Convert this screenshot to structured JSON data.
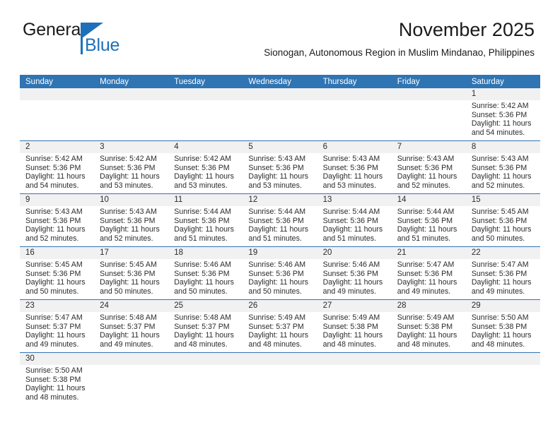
{
  "logo": {
    "text_primary": "General",
    "text_secondary": "Blue",
    "color_primary": "#1a1a1a",
    "color_secondary": "#1d70b7"
  },
  "header": {
    "title": "November 2025",
    "subtitle": "Sionogan, Autonomous Region in Muslim Mindanao, Philippines"
  },
  "theme": {
    "header_blue": "#2f74b3",
    "daynum_band": "#f1f1f1",
    "text": "#2b2b2b"
  },
  "calendar": {
    "weekdays": [
      "Sunday",
      "Monday",
      "Tuesday",
      "Wednesday",
      "Thursday",
      "Friday",
      "Saturday"
    ],
    "weeks": [
      [
        {
          "day": "",
          "lines": []
        },
        {
          "day": "",
          "lines": []
        },
        {
          "day": "",
          "lines": []
        },
        {
          "day": "",
          "lines": []
        },
        {
          "day": "",
          "lines": []
        },
        {
          "day": "",
          "lines": []
        },
        {
          "day": "1",
          "lines": [
            "Sunrise: 5:42 AM",
            "Sunset: 5:36 PM",
            "Daylight: 11 hours",
            "and 54 minutes."
          ]
        }
      ],
      [
        {
          "day": "2",
          "lines": [
            "Sunrise: 5:42 AM",
            "Sunset: 5:36 PM",
            "Daylight: 11 hours",
            "and 54 minutes."
          ]
        },
        {
          "day": "3",
          "lines": [
            "Sunrise: 5:42 AM",
            "Sunset: 5:36 PM",
            "Daylight: 11 hours",
            "and 53 minutes."
          ]
        },
        {
          "day": "4",
          "lines": [
            "Sunrise: 5:42 AM",
            "Sunset: 5:36 PM",
            "Daylight: 11 hours",
            "and 53 minutes."
          ]
        },
        {
          "day": "5",
          "lines": [
            "Sunrise: 5:43 AM",
            "Sunset: 5:36 PM",
            "Daylight: 11 hours",
            "and 53 minutes."
          ]
        },
        {
          "day": "6",
          "lines": [
            "Sunrise: 5:43 AM",
            "Sunset: 5:36 PM",
            "Daylight: 11 hours",
            "and 53 minutes."
          ]
        },
        {
          "day": "7",
          "lines": [
            "Sunrise: 5:43 AM",
            "Sunset: 5:36 PM",
            "Daylight: 11 hours",
            "and 52 minutes."
          ]
        },
        {
          "day": "8",
          "lines": [
            "Sunrise: 5:43 AM",
            "Sunset: 5:36 PM",
            "Daylight: 11 hours",
            "and 52 minutes."
          ]
        }
      ],
      [
        {
          "day": "9",
          "lines": [
            "Sunrise: 5:43 AM",
            "Sunset: 5:36 PM",
            "Daylight: 11 hours",
            "and 52 minutes."
          ]
        },
        {
          "day": "10",
          "lines": [
            "Sunrise: 5:43 AM",
            "Sunset: 5:36 PM",
            "Daylight: 11 hours",
            "and 52 minutes."
          ]
        },
        {
          "day": "11",
          "lines": [
            "Sunrise: 5:44 AM",
            "Sunset: 5:36 PM",
            "Daylight: 11 hours",
            "and 51 minutes."
          ]
        },
        {
          "day": "12",
          "lines": [
            "Sunrise: 5:44 AM",
            "Sunset: 5:36 PM",
            "Daylight: 11 hours",
            "and 51 minutes."
          ]
        },
        {
          "day": "13",
          "lines": [
            "Sunrise: 5:44 AM",
            "Sunset: 5:36 PM",
            "Daylight: 11 hours",
            "and 51 minutes."
          ]
        },
        {
          "day": "14",
          "lines": [
            "Sunrise: 5:44 AM",
            "Sunset: 5:36 PM",
            "Daylight: 11 hours",
            "and 51 minutes."
          ]
        },
        {
          "day": "15",
          "lines": [
            "Sunrise: 5:45 AM",
            "Sunset: 5:36 PM",
            "Daylight: 11 hours",
            "and 50 minutes."
          ]
        }
      ],
      [
        {
          "day": "16",
          "lines": [
            "Sunrise: 5:45 AM",
            "Sunset: 5:36 PM",
            "Daylight: 11 hours",
            "and 50 minutes."
          ]
        },
        {
          "day": "17",
          "lines": [
            "Sunrise: 5:45 AM",
            "Sunset: 5:36 PM",
            "Daylight: 11 hours",
            "and 50 minutes."
          ]
        },
        {
          "day": "18",
          "lines": [
            "Sunrise: 5:46 AM",
            "Sunset: 5:36 PM",
            "Daylight: 11 hours",
            "and 50 minutes."
          ]
        },
        {
          "day": "19",
          "lines": [
            "Sunrise: 5:46 AM",
            "Sunset: 5:36 PM",
            "Daylight: 11 hours",
            "and 50 minutes."
          ]
        },
        {
          "day": "20",
          "lines": [
            "Sunrise: 5:46 AM",
            "Sunset: 5:36 PM",
            "Daylight: 11 hours",
            "and 49 minutes."
          ]
        },
        {
          "day": "21",
          "lines": [
            "Sunrise: 5:47 AM",
            "Sunset: 5:36 PM",
            "Daylight: 11 hours",
            "and 49 minutes."
          ]
        },
        {
          "day": "22",
          "lines": [
            "Sunrise: 5:47 AM",
            "Sunset: 5:36 PM",
            "Daylight: 11 hours",
            "and 49 minutes."
          ]
        }
      ],
      [
        {
          "day": "23",
          "lines": [
            "Sunrise: 5:47 AM",
            "Sunset: 5:37 PM",
            "Daylight: 11 hours",
            "and 49 minutes."
          ]
        },
        {
          "day": "24",
          "lines": [
            "Sunrise: 5:48 AM",
            "Sunset: 5:37 PM",
            "Daylight: 11 hours",
            "and 49 minutes."
          ]
        },
        {
          "day": "25",
          "lines": [
            "Sunrise: 5:48 AM",
            "Sunset: 5:37 PM",
            "Daylight: 11 hours",
            "and 48 minutes."
          ]
        },
        {
          "day": "26",
          "lines": [
            "Sunrise: 5:49 AM",
            "Sunset: 5:37 PM",
            "Daylight: 11 hours",
            "and 48 minutes."
          ]
        },
        {
          "day": "27",
          "lines": [
            "Sunrise: 5:49 AM",
            "Sunset: 5:38 PM",
            "Daylight: 11 hours",
            "and 48 minutes."
          ]
        },
        {
          "day": "28",
          "lines": [
            "Sunrise: 5:49 AM",
            "Sunset: 5:38 PM",
            "Daylight: 11 hours",
            "and 48 minutes."
          ]
        },
        {
          "day": "29",
          "lines": [
            "Sunrise: 5:50 AM",
            "Sunset: 5:38 PM",
            "Daylight: 11 hours",
            "and 48 minutes."
          ]
        }
      ],
      [
        {
          "day": "30",
          "lines": [
            "Sunrise: 5:50 AM",
            "Sunset: 5:38 PM",
            "Daylight: 11 hours",
            "and 48 minutes."
          ]
        },
        {
          "day": "",
          "lines": []
        },
        {
          "day": "",
          "lines": []
        },
        {
          "day": "",
          "lines": []
        },
        {
          "day": "",
          "lines": []
        },
        {
          "day": "",
          "lines": []
        },
        {
          "day": "",
          "lines": []
        }
      ]
    ]
  }
}
